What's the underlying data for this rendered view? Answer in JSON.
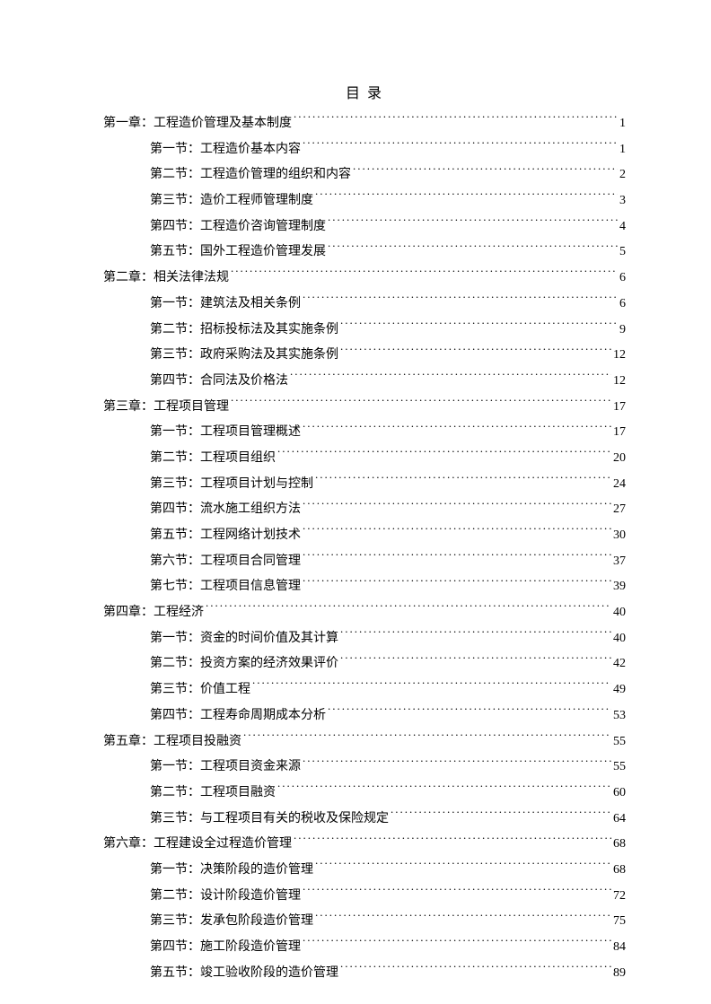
{
  "title": "目 录",
  "toc": [
    {
      "level": "chapter",
      "text": "第一章：工程造价管理及基本制度",
      "page": "1"
    },
    {
      "level": "section",
      "text": "第一节：工程造价基本内容",
      "page": "1"
    },
    {
      "level": "section",
      "text": "第二节：工程造价管理的组织和内容",
      "page": "2"
    },
    {
      "level": "section",
      "text": "第三节：造价工程师管理制度",
      "page": "3"
    },
    {
      "level": "section",
      "text": "第四节：工程造价咨询管理制度",
      "page": "4"
    },
    {
      "level": "section",
      "text": "第五节：国外工程造价管理发展",
      "page": "5"
    },
    {
      "level": "chapter",
      "text": "第二章：相关法律法规",
      "page": "6"
    },
    {
      "level": "section",
      "text": "第一节：建筑法及相关条例",
      "page": "6"
    },
    {
      "level": "section",
      "text": "第二节：招标投标法及其实施条例",
      "page": "9"
    },
    {
      "level": "section",
      "text": "第三节：政府采购法及其实施条例",
      "page": "12"
    },
    {
      "level": "section",
      "text": "第四节：合同法及价格法",
      "page": "12"
    },
    {
      "level": "chapter",
      "text": "第三章：工程项目管理",
      "page": "17"
    },
    {
      "level": "section",
      "text": "第一节：工程项目管理概述",
      "page": "17"
    },
    {
      "level": "section",
      "text": "第二节：工程项目组织",
      "page": "20"
    },
    {
      "level": "section",
      "text": "第三节：工程项目计划与控制",
      "page": "24"
    },
    {
      "level": "section",
      "text": "第四节：流水施工组织方法",
      "page": "27"
    },
    {
      "level": "section",
      "text": "第五节：工程网络计划技术",
      "page": "30"
    },
    {
      "level": "section",
      "text": "第六节：工程项目合同管理",
      "page": "37"
    },
    {
      "level": "section",
      "text": "第七节：工程项目信息管理",
      "page": "39"
    },
    {
      "level": "chapter",
      "text": "第四章：工程经济",
      "page": "40"
    },
    {
      "level": "section",
      "text": "第一节：资金的时间价值及其计算",
      "page": "40"
    },
    {
      "level": "section",
      "text": "第二节：投资方案的经济效果评价",
      "page": "42"
    },
    {
      "level": "section",
      "text": "第三节：价值工程",
      "page": "49"
    },
    {
      "level": "section",
      "text": "第四节：工程寿命周期成本分析",
      "page": "53"
    },
    {
      "level": "chapter",
      "text": "第五章：工程项目投融资",
      "page": "55"
    },
    {
      "level": "section",
      "text": "第一节：工程项目资金来源",
      "page": "55"
    },
    {
      "level": "section",
      "text": "第二节：工程项目融资",
      "page": "60"
    },
    {
      "level": "section",
      "text": "第三节：与工程项目有关的税收及保险规定",
      "page": "64"
    },
    {
      "level": "chapter",
      "text": "第六章：工程建设全过程造价管理",
      "page": "68"
    },
    {
      "level": "section",
      "text": "第一节：决策阶段的造价管理",
      "page": "68"
    },
    {
      "level": "section",
      "text": "第二节：设计阶段造价管理",
      "page": "72"
    },
    {
      "level": "section",
      "text": "第三节：发承包阶段造价管理",
      "page": "75"
    },
    {
      "level": "section",
      "text": "第四节：施工阶段造价管理",
      "page": "84"
    },
    {
      "level": "section",
      "text": "第五节：竣工验收阶段的造价管理",
      "page": "89"
    }
  ]
}
